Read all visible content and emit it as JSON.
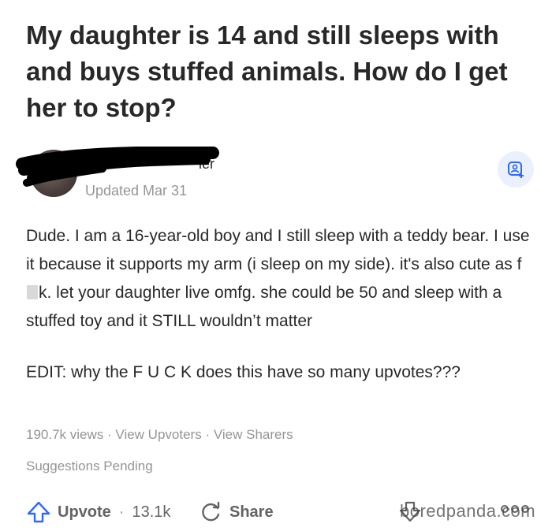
{
  "question": {
    "title": "My daughter is 14 and still sleeps with and buys stuffed animals. How do I get her to stop?"
  },
  "author": {
    "name_visible_fragment": "ier",
    "updated": "Updated Mar 31"
  },
  "answer": {
    "line1": "Dude. I am a 16-year-old boy and I still sleep with a teddy bear. I use it because it supports my arm (i sleep on my side). it's also cute as f",
    "line1_after": "k. let your daughter live omfg. she could be 50 and sleep with a stuffed toy and it STILL wouldn’t matter",
    "edit": "EDIT: why the F U C K does this have so many upvotes???"
  },
  "meta": {
    "views": "190.7k views",
    "sep1": "·",
    "view_upvoters": "View Upvoters",
    "sep2": "·",
    "view_sharers": "View Sharers",
    "suggestions": "Suggestions Pending"
  },
  "actions": {
    "upvote_label": "Upvote",
    "sep": "·",
    "upvote_count": "13.1k",
    "share_label": "Share"
  },
  "watermark": "boredpanda.com",
  "colors": {
    "accent_blue": "#2e69ff",
    "follow_bg": "#ebf0ff",
    "muted": "#939598"
  }
}
